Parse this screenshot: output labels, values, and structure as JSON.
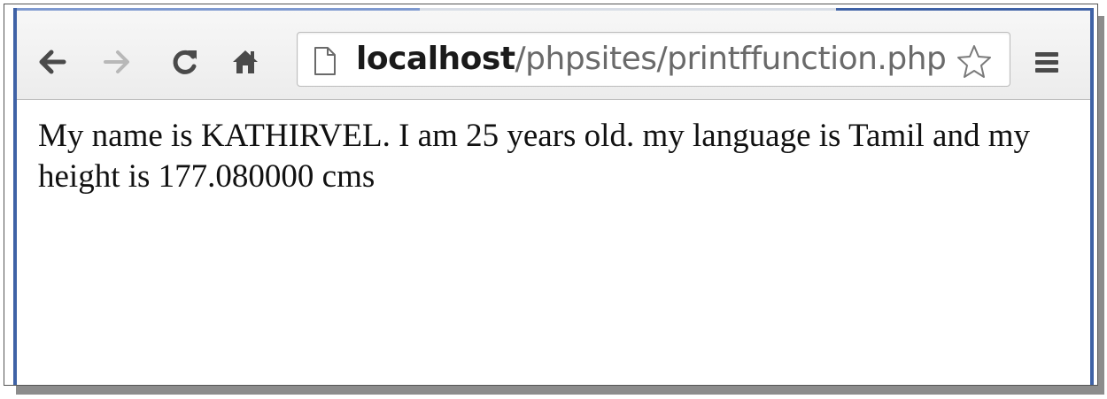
{
  "browser": {
    "toolbar": {
      "back_icon": "back-arrow-icon",
      "forward_icon": "forward-arrow-icon",
      "reload_icon": "reload-icon",
      "home_icon": "home-icon",
      "menu_icon": "hamburger-menu-icon"
    },
    "address_bar": {
      "host": "localhost",
      "path": "/phpsites/printffunction.php",
      "page_icon": "page-document-icon",
      "bookmark_icon": "star-outline-icon"
    },
    "colors": {
      "frame_accent": "#3f62a6",
      "toolbar_bg": "#f2f2f2",
      "icon_active": "#4a4a4a",
      "icon_disabled": "#b8b8b8"
    }
  },
  "page": {
    "output_text": "My name is KATHIRVEL. I am 25 years old. my language is Tamil and my height is 177.080000 cms"
  }
}
